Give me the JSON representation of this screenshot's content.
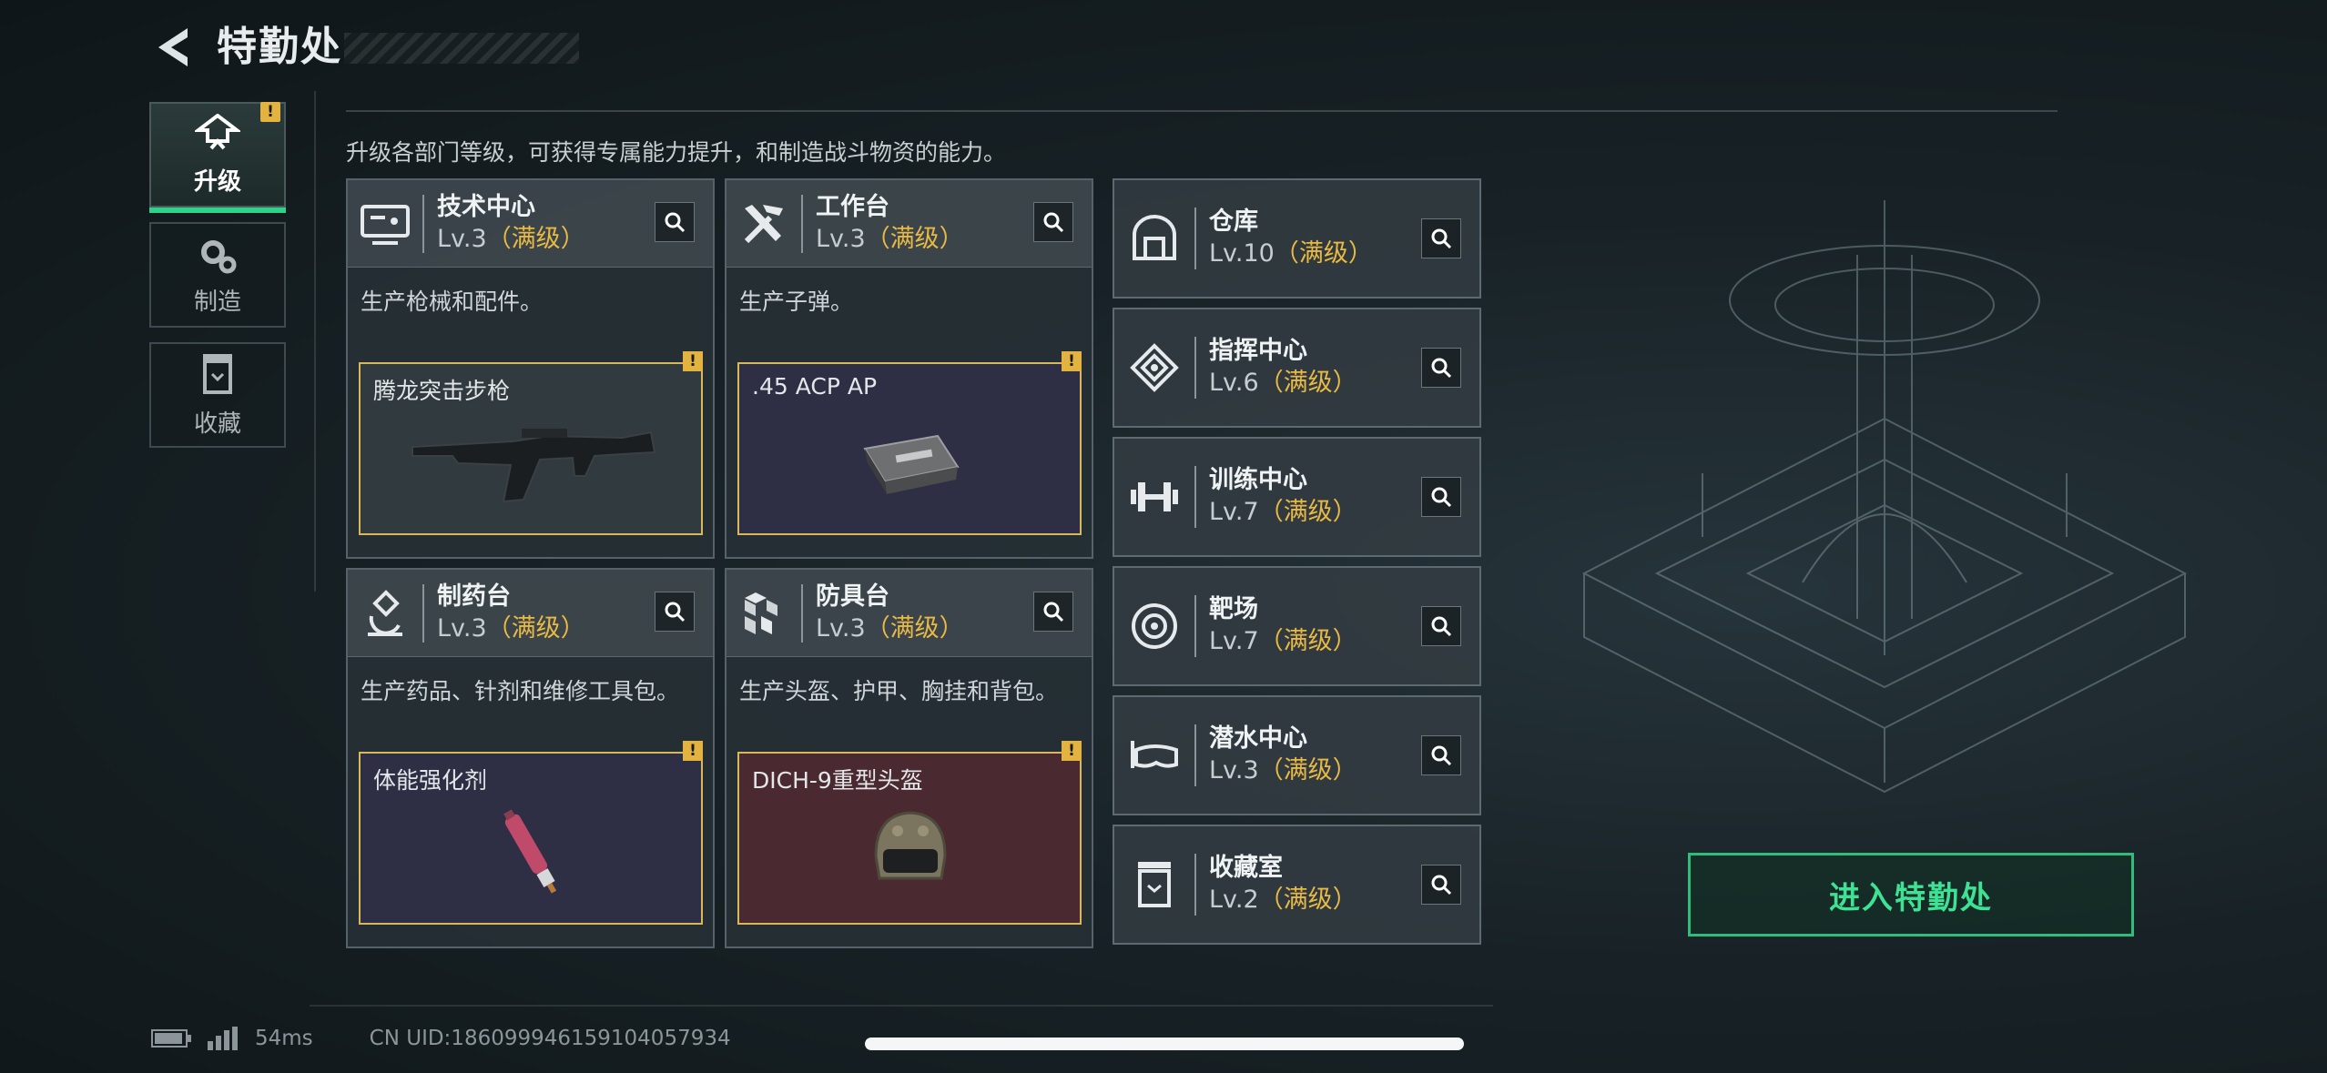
{
  "header": {
    "title": "特勤处"
  },
  "tabs": [
    {
      "label": "升级",
      "icon": "upgrade-icon",
      "active": true,
      "badge": "!"
    },
    {
      "label": "制造",
      "icon": "craft-gear-icon",
      "active": false
    },
    {
      "label": "收藏",
      "icon": "collection-icon",
      "active": false
    }
  ],
  "description": "升级各部门等级，可获得专属能力提升，和制造战斗物资的能力。",
  "facilities": [
    {
      "name": "技术中心",
      "level": "Lv.3",
      "max": "（满级）",
      "desc": "生产枪械和配件。",
      "product": "腾龙突击步枪",
      "badge": "!",
      "icon": "tech-center-icon"
    },
    {
      "name": "工作台",
      "level": "Lv.3",
      "max": "（满级）",
      "desc": "生产子弹。",
      "product": ".45 ACP AP",
      "badge": "!",
      "icon": "workbench-tools-icon"
    },
    {
      "name": "制药台",
      "level": "Lv.3",
      "max": "（满级）",
      "desc": "生产药品、针剂和维修工具包。",
      "product": "体能强化剂",
      "badge": "!",
      "icon": "microscope-icon"
    },
    {
      "name": "防具台",
      "level": "Lv.3",
      "max": "（满级）",
      "desc": "生产头盔、护甲、胸挂和背包。",
      "product": "DICH-9重型头盔",
      "badge": "!",
      "icon": "armor-cubes-icon"
    }
  ],
  "rooms": [
    {
      "name": "仓库",
      "level": "Lv.10",
      "max": "（满级）",
      "icon": "warehouse-icon"
    },
    {
      "name": "指挥中心",
      "level": "Lv.6",
      "max": "（满级）",
      "icon": "command-center-icon"
    },
    {
      "name": "训练中心",
      "level": "Lv.7",
      "max": "（满级）",
      "icon": "dumbbell-icon"
    },
    {
      "name": "靶场",
      "level": "Lv.7",
      "max": "（满级）",
      "icon": "target-icon"
    },
    {
      "name": "潜水中心",
      "level": "Lv.3",
      "max": "（满级）",
      "icon": "diving-mask-icon"
    },
    {
      "name": "收藏室",
      "level": "Lv.2",
      "max": "（满级）",
      "icon": "collection-room-icon"
    }
  ],
  "enter_button": "进入特勤处",
  "footer": {
    "ping": "54ms",
    "uid": "CN UID:1860999461591040579​34"
  },
  "colors": {
    "accent_green": "#2fd28a",
    "max_level_gold": "#e8b945",
    "badge_yellow": "#e3b341"
  }
}
